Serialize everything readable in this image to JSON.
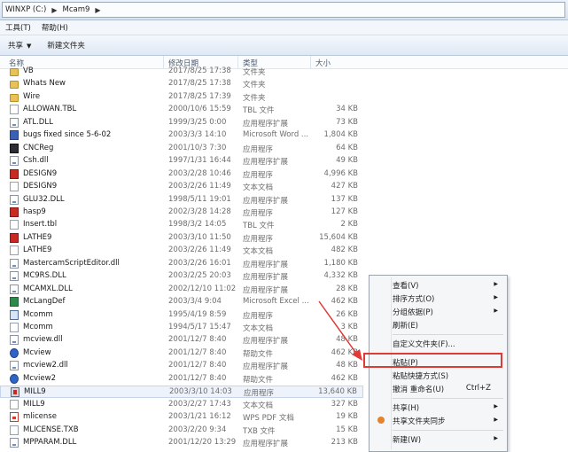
{
  "address_bar": {
    "segments": [
      "WINXP (C:)",
      "Mcam9"
    ]
  },
  "menu": [
    "工具(T)",
    "帮助(H)"
  ],
  "toolbar": {
    "share_label": "共享",
    "new_folder_label": "新建文件夹"
  },
  "columns": {
    "name": "名称",
    "date": "修改日期",
    "type": "类型",
    "size": "大小"
  },
  "files": [
    {
      "name": "VB",
      "date": "2017/8/25 17:38",
      "type": "文件夹",
      "size": "",
      "icon": "folder-icon"
    },
    {
      "name": "Whats New",
      "date": "2017/8/25 17:38",
      "type": "文件夹",
      "size": "",
      "icon": "folder-icon"
    },
    {
      "name": "Wire",
      "date": "2017/8/25 17:39",
      "type": "文件夹",
      "size": "",
      "icon": "folder-icon"
    },
    {
      "name": "ALLOWAN.TBL",
      "date": "2000/10/6 15:59",
      "type": "TBL 文件",
      "size": "34 KB",
      "icon": "file-icon"
    },
    {
      "name": "ATL.DLL",
      "date": "1999/3/25 0:00",
      "type": "应用程序扩展",
      "size": "73 KB",
      "icon": "dll-icon"
    },
    {
      "name": "bugs fixed since 5-6-02",
      "date": "2003/3/3 14:10",
      "type": "Microsoft Word ...",
      "size": "1,804 KB",
      "icon": "word-doc-icon"
    },
    {
      "name": "CNCReg",
      "date": "2001/10/3 7:30",
      "type": "应用程序",
      "size": "64 KB",
      "icon": "cncreg-app-icon"
    },
    {
      "name": "Csh.dll",
      "date": "1997/1/31 16:44",
      "type": "应用程序扩展",
      "size": "49 KB",
      "icon": "dll-icon"
    },
    {
      "name": "DESIGN9",
      "date": "2003/2/28 10:46",
      "type": "应用程序",
      "size": "4,996 KB",
      "icon": "design-app-icon"
    },
    {
      "name": "DESIGN9",
      "date": "2003/2/26 11:49",
      "type": "文本文档",
      "size": "427 KB",
      "icon": "text-file-icon"
    },
    {
      "name": "GLU32.DLL",
      "date": "1998/5/11 19:01",
      "type": "应用程序扩展",
      "size": "137 KB",
      "icon": "dll-icon"
    },
    {
      "name": "hasp9",
      "date": "2002/3/28 14:28",
      "type": "应用程序",
      "size": "127 KB",
      "icon": "hasp-app-icon"
    },
    {
      "name": "Insert.tbl",
      "date": "1998/3/2 14:05",
      "type": "TBL 文件",
      "size": "2 KB",
      "icon": "file-icon"
    },
    {
      "name": "LATHE9",
      "date": "2003/3/10 11:50",
      "type": "应用程序",
      "size": "15,604 KB",
      "icon": "lathe-app-icon"
    },
    {
      "name": "LATHE9",
      "date": "2003/2/26 11:49",
      "type": "文本文档",
      "size": "482 KB",
      "icon": "text-file-icon"
    },
    {
      "name": "MastercamScriptEditor.dll",
      "date": "2003/2/26 16:01",
      "type": "应用程序扩展",
      "size": "1,180 KB",
      "icon": "dll-icon"
    },
    {
      "name": "MC9RS.DLL",
      "date": "2003/2/25 20:03",
      "type": "应用程序扩展",
      "size": "4,332 KB",
      "icon": "dll-icon"
    },
    {
      "name": "MCAMXL.DLL",
      "date": "2002/12/10 11:02",
      "type": "应用程序扩展",
      "size": "28 KB",
      "icon": "dll-icon"
    },
    {
      "name": "McLangDef",
      "date": "2003/3/4 9:04",
      "type": "Microsoft Excel ...",
      "size": "462 KB",
      "icon": "excel-icon"
    },
    {
      "name": "Mcomm",
      "date": "1995/4/19 8:59",
      "type": "应用程序",
      "size": "26 KB",
      "icon": "app-icon"
    },
    {
      "name": "Mcomm",
      "date": "1994/5/17 15:47",
      "type": "文本文档",
      "size": "3 KB",
      "icon": "text-file-icon"
    },
    {
      "name": "mcview.dll",
      "date": "2001/12/7 8:40",
      "type": "应用程序扩展",
      "size": "48 KB",
      "icon": "dll-icon"
    },
    {
      "name": "Mcview",
      "date": "2001/12/7 8:40",
      "type": "帮助文件",
      "size": "462 KB",
      "icon": "help-file-icon"
    },
    {
      "name": "mcview2.dll",
      "date": "2001/12/7 8:40",
      "type": "应用程序扩展",
      "size": "48 KB",
      "icon": "dll-icon"
    },
    {
      "name": "Mcview2",
      "date": "2001/12/7 8:40",
      "type": "帮助文件",
      "size": "462 KB",
      "icon": "help-file-icon"
    },
    {
      "name": "MILL9",
      "date": "2003/3/10 14:03",
      "type": "应用程序",
      "size": "13,640 KB",
      "icon": "mill-app-icon"
    },
    {
      "name": "MILL9",
      "date": "2003/2/27 17:43",
      "type": "文本文档",
      "size": "327 KB",
      "icon": "text-file-icon"
    },
    {
      "name": "mlicense",
      "date": "2003/1/21 16:12",
      "type": "WPS PDF 文档",
      "size": "19 KB",
      "icon": "pdf-icon"
    },
    {
      "name": "MLICENSE.TXB",
      "date": "2003/2/20 9:34",
      "type": "TXB 文件",
      "size": "15 KB",
      "icon": "file-icon"
    },
    {
      "name": "MPPARAM.DLL",
      "date": "2001/12/20 13:29",
      "type": "应用程序扩展",
      "size": "213 KB",
      "icon": "dll-icon"
    }
  ],
  "context_menu": {
    "view": "查看(V)",
    "sort_by": "排序方式(O)",
    "group_by": "分组依据(P)",
    "refresh": "刷新(E)",
    "customize_folder": "自定义文件夹(F)...",
    "paste": "粘贴(P)",
    "paste_shortcut": "粘贴快捷方式(S)",
    "undo_rename": "撤消 重命名(U)",
    "undo_shortcut": "Ctrl+Z",
    "share_with": "共享(H)",
    "shared_folder_sync": "共享文件夹同步",
    "new": "新建(W)"
  },
  "annotation": {
    "highlight_color": "#e03a37"
  }
}
